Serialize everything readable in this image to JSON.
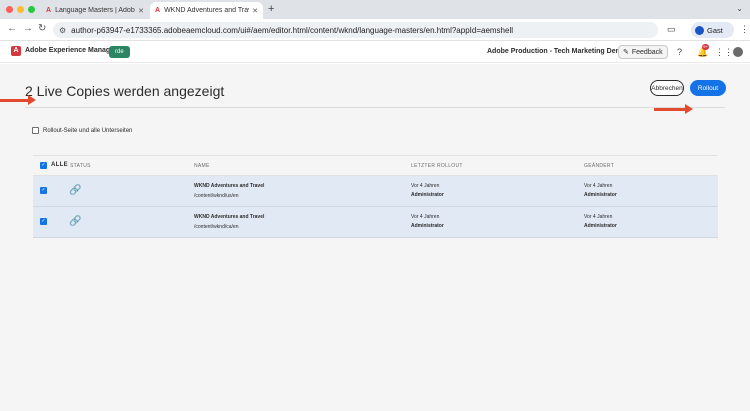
{
  "browser": {
    "tabs": [
      {
        "favicon": "A",
        "title": "Language Masters | Adobe E...",
        "active": false
      },
      {
        "favicon": "A",
        "title": "WKND Adventures and Trave...",
        "active": true
      }
    ],
    "url": "author-p63947-e1733365.adobeaemcloud.com/ui#/aem/editor.html/content/wknd/language-masters/en.html?appId=aemshell",
    "profile_label": "Gast",
    "icons": [
      "back-icon",
      "forward-icon",
      "reload-icon",
      "tune-icon",
      "cast-icon",
      "menu-icon"
    ]
  },
  "shell": {
    "product_name": "Adobe Experience Manager",
    "env_badge": "rde",
    "org_name": "Adobe Production - Tech Marketing Demos",
    "feedback_label": "Feedback",
    "notification_count": "9+"
  },
  "page": {
    "title": "2 Live Copies werden angezeigt",
    "cancel_label": "Abbrechen",
    "rollout_label": "Rollout",
    "rollout_option_label": "Rollout-Seite und alle Unterseiten",
    "rollout_option_checked": false
  },
  "table": {
    "select_all_label": "ALLE",
    "columns": [
      "STATUS",
      "NAME",
      "LETZTER ROLLOUT",
      "GEÄNDERT"
    ],
    "rows": [
      {
        "checked": true,
        "status_icon": "link-icon",
        "name": "WKND Adventures and Travel",
        "path": "/content/wknd/us/en",
        "last_rollout_time": "Vor 4 Jahren",
        "last_rollout_user": "Administrator",
        "modified_time": "Vor 4 Jahren",
        "modified_user": "Administrator"
      },
      {
        "checked": true,
        "status_icon": "link-icon",
        "name": "WKND Adventures and Travel",
        "path": "/content/wknd/ca/en",
        "last_rollout_time": "Vor 4 Jahren",
        "last_rollout_user": "Administrator",
        "modified_time": "Vor 4 Jahren",
        "modified_user": "Administrator"
      }
    ]
  },
  "colors": {
    "accent": "#1473e6",
    "brand_red": "#d7373f",
    "annotation_arrow": "#e34a2d",
    "row_selected": "#e1e9f4"
  }
}
